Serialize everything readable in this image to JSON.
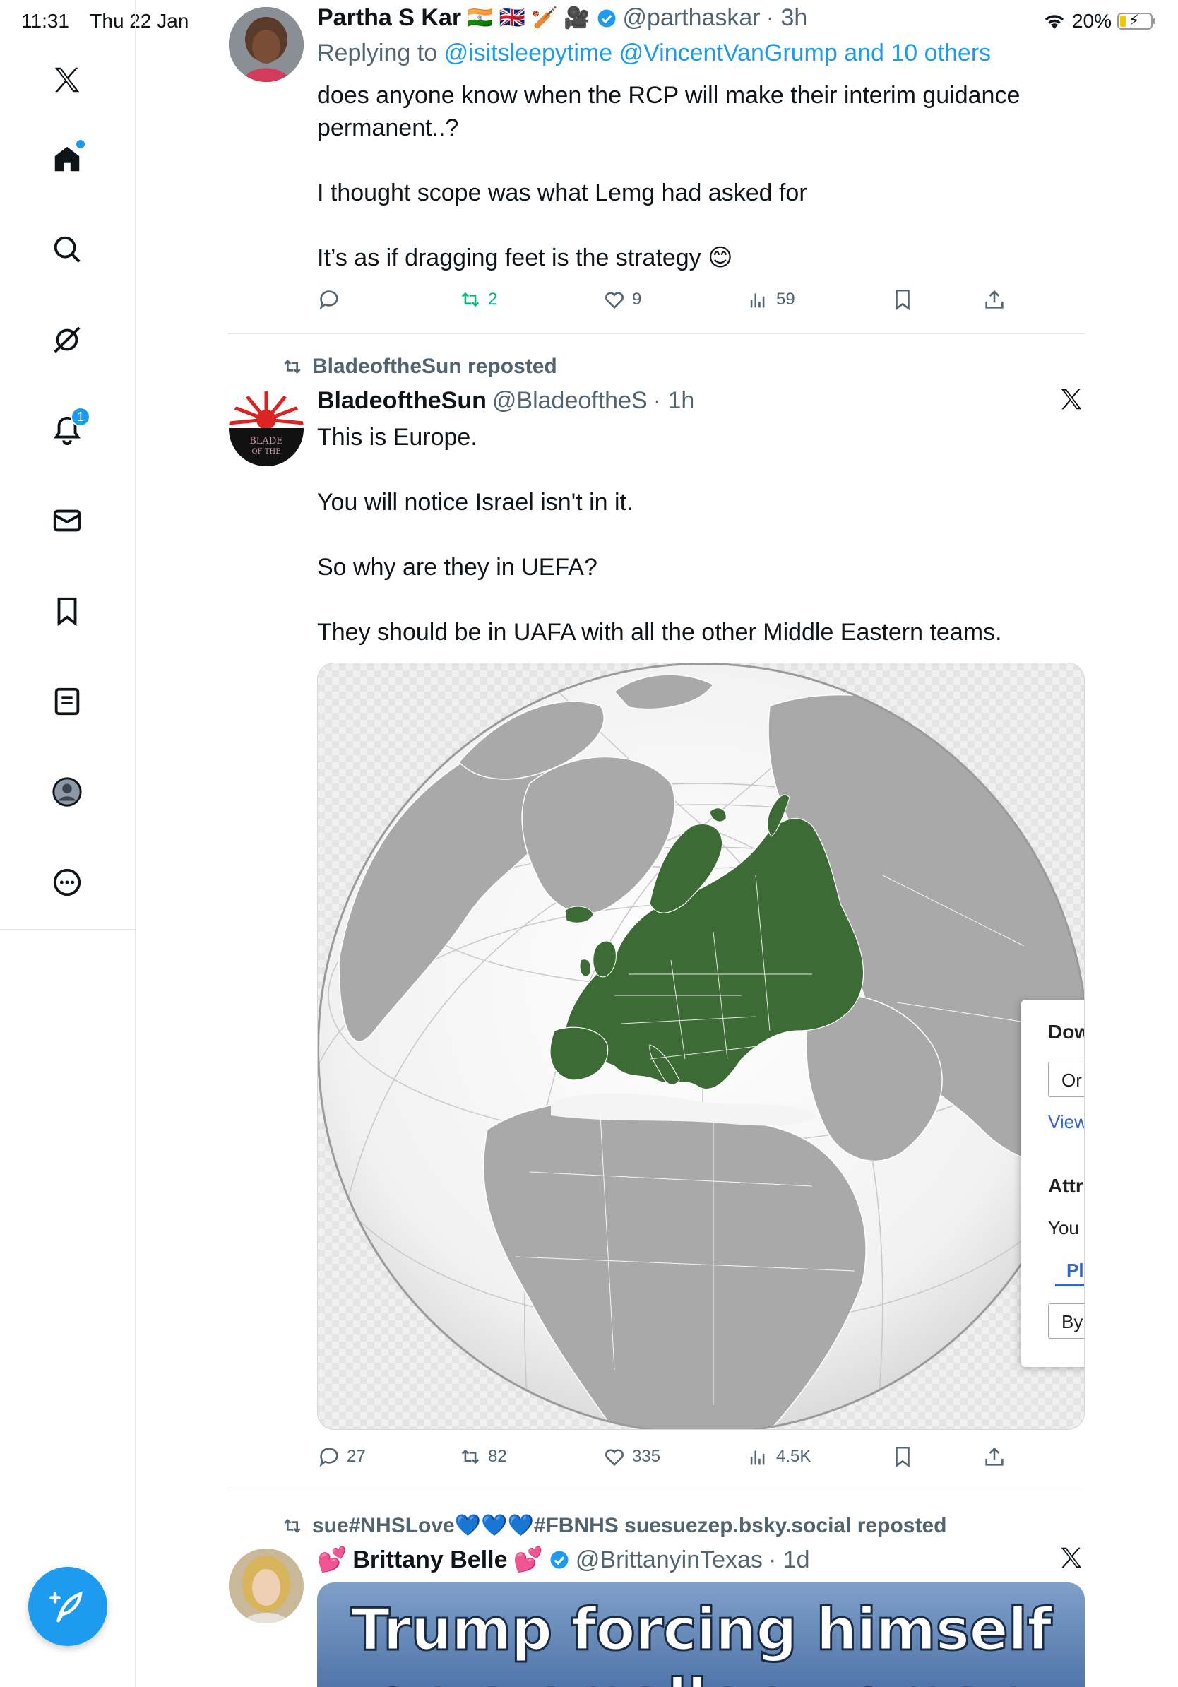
{
  "status_bar": {
    "time": "11:31",
    "date": "Thu 22 Jan",
    "battery": "20%",
    "battery_level": 0.2
  },
  "sidebar": {
    "items": [
      {
        "icon": "x-logo-icon"
      },
      {
        "icon": "home-icon"
      },
      {
        "icon": "search-icon"
      },
      {
        "icon": "grok-icon"
      },
      {
        "icon": "notifications-icon",
        "badge": "1"
      },
      {
        "icon": "messages-icon"
      },
      {
        "icon": "bookmarks-icon"
      },
      {
        "icon": "lists-icon"
      },
      {
        "icon": "profile-icon"
      },
      {
        "icon": "more-icon"
      }
    ],
    "compose_icon": "compose-icon"
  },
  "tweets": [
    {
      "name": "Partha S Kar",
      "flags": "🇮🇳 🇬🇧 🏏 🎥",
      "handle": "@parthaskar",
      "time": "· 3h",
      "reply_label": "Replying to",
      "reply_targets": "@isitsleepytime @VincentVanGrump and 10 others",
      "body": [
        "does anyone know when the RCP will make their interim guidance permanent..?",
        "I thought scope was what Lemg had asked for",
        "It’s as if dragging feet is the strategy 😊"
      ],
      "stats": {
        "replies": "",
        "reposts": "2",
        "likes": "9",
        "views": "59"
      }
    },
    {
      "repost_by": "BladeoftheSun reposted",
      "name": "BladeoftheSun",
      "handle": "@BladeoftheS",
      "time": "· 1h",
      "body": [
        "This is Europe.",
        "You will notice Israel isn't in it.",
        "So why are they in UEFA?",
        "They should be in UAFA with all the other Middle Eastern teams."
      ],
      "media_overlay": {
        "title": "Dow",
        "select": "Or",
        "link": "View",
        "heading": "Attr",
        "text": "You",
        "tab": "Pl",
        "select2": "By"
      },
      "stats": {
        "replies": "27",
        "reposts": "82",
        "likes": "335",
        "views": "4.5K"
      }
    },
    {
      "repost_by": "sue#NHSLove💙💙💙#FBNHS suesuezep.bsky.social reposted",
      "name_prefix": "💕",
      "name": "Brittany Belle",
      "name_suffix": "💕",
      "handle": "@BrittanyinTexas",
      "time": "· 1d",
      "media_text": "Trump forcing himself",
      "media_text2": "on a smaller woman"
    }
  ],
  "colors": {
    "accent": "#1d9bf0",
    "europe_green": "#3d6b35",
    "land_gray": "#a9a9a9"
  }
}
